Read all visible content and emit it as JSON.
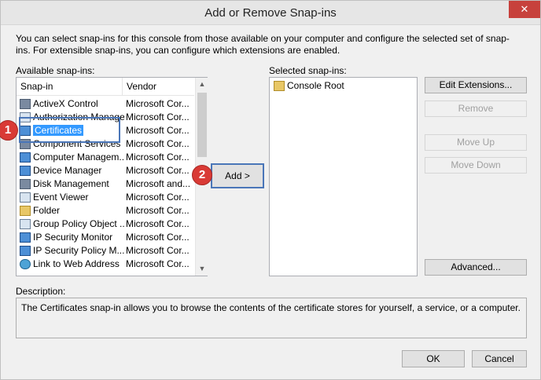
{
  "window": {
    "title": "Add or Remove Snap-ins",
    "close_label": "✕"
  },
  "intro_text": "You can select snap-ins for this console from those available on your computer and configure the selected set of snap-ins. For extensible snap-ins, you can configure which extensions are enabled.",
  "available": {
    "label": "Available snap-ins:",
    "columns": [
      "Snap-in",
      "Vendor"
    ],
    "rows": [
      {
        "name": "ActiveX Control",
        "vendor": "Microsoft Cor...",
        "icon": "activex-icon"
      },
      {
        "name": "Authorization Manager",
        "vendor": "Microsoft Cor...",
        "icon": "authorization-manager-icon"
      },
      {
        "name": "Certificates",
        "vendor": "Microsoft Cor...",
        "icon": "certificates-icon"
      },
      {
        "name": "Component Services",
        "vendor": "Microsoft Cor...",
        "icon": "component-services-icon"
      },
      {
        "name": "Computer Managem...",
        "vendor": "Microsoft Cor...",
        "icon": "computer-management-icon"
      },
      {
        "name": "Device Manager",
        "vendor": "Microsoft Cor...",
        "icon": "device-manager-icon"
      },
      {
        "name": "Disk Management",
        "vendor": "Microsoft and...",
        "icon": "disk-management-icon"
      },
      {
        "name": "Event Viewer",
        "vendor": "Microsoft Cor...",
        "icon": "event-viewer-icon"
      },
      {
        "name": "Folder",
        "vendor": "Microsoft Cor...",
        "icon": "folder-icon"
      },
      {
        "name": "Group Policy Object ...",
        "vendor": "Microsoft Cor...",
        "icon": "group-policy-icon"
      },
      {
        "name": "IP Security Monitor",
        "vendor": "Microsoft Cor...",
        "icon": "ip-security-monitor-icon"
      },
      {
        "name": "IP Security Policy M...",
        "vendor": "Microsoft Cor...",
        "icon": "ip-security-policy-icon"
      },
      {
        "name": "Link to Web Address",
        "vendor": "Microsoft Cor...",
        "icon": "link-to-web-address-icon"
      }
    ],
    "selected_index": 2
  },
  "add_button": "Add >",
  "selected": {
    "label": "Selected snap-ins:",
    "items": [
      "Console Root"
    ]
  },
  "buttons": {
    "edit_extensions": "Edit Extensions...",
    "remove": "Remove",
    "move_up": "Move Up",
    "move_down": "Move Down",
    "advanced": "Advanced...",
    "ok": "OK",
    "cancel": "Cancel"
  },
  "description": {
    "label": "Description:",
    "text": "The Certificates snap-in allows you to browse the contents of the certificate stores for yourself, a service, or a computer."
  },
  "callouts": [
    "1",
    "2"
  ],
  "colors": {
    "callout_red": "#d93a35",
    "callout_outline": "#4a76b8",
    "selection": "#3399ff"
  }
}
